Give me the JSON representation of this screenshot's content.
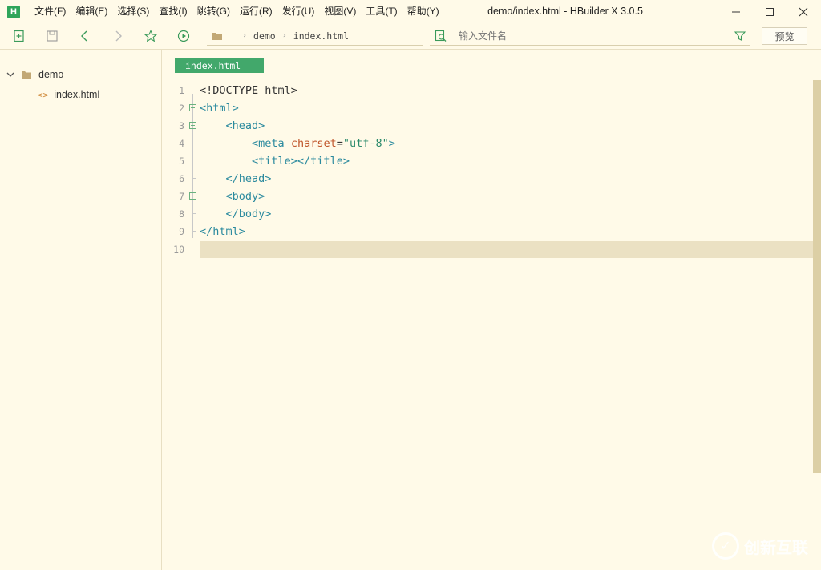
{
  "app": {
    "logo_letter": "H",
    "window_title": "demo/index.html - HBuilder X 3.0.5"
  },
  "menu": [
    "文件(F)",
    "编辑(E)",
    "选择(S)",
    "查找(I)",
    "跳转(G)",
    "运行(R)",
    "发行(U)",
    "视图(V)",
    "工具(T)",
    "帮助(Y)"
  ],
  "toolbar": {
    "breadcrumb": [
      "demo",
      "index.html"
    ],
    "search_placeholder": "输入文件名",
    "preview_label": "预览"
  },
  "sidebar": {
    "project": "demo",
    "files": [
      "index.html"
    ]
  },
  "editor": {
    "tab_label": "index.html",
    "line_numbers": [
      "1",
      "2",
      "3",
      "4",
      "5",
      "6",
      "7",
      "8",
      "9",
      "10"
    ],
    "lines": {
      "l1": "<!DOCTYPE html>",
      "l2_tag": "<html>",
      "l3_tag": "<head>",
      "l4_tag_open": "<meta",
      "l4_attr": "charset",
      "l4_eq": "=",
      "l4_str": "\"utf-8\"",
      "l4_close": ">",
      "l5_tag": "<title></title>",
      "l6_tag": "</head>",
      "l7_tag": "<body>",
      "l8_tag": "</body>",
      "l9_tag": "</html>",
      "l10": ""
    },
    "current_line": "10"
  },
  "watermark": {
    "text": "创新互联"
  },
  "colors": {
    "background": "#fffae8",
    "accent_green": "#42a86b",
    "tag": "#2b8a9e",
    "attribute": "#c0562b",
    "string": "#2a8a6a",
    "current_line": "#ebe1c3"
  }
}
